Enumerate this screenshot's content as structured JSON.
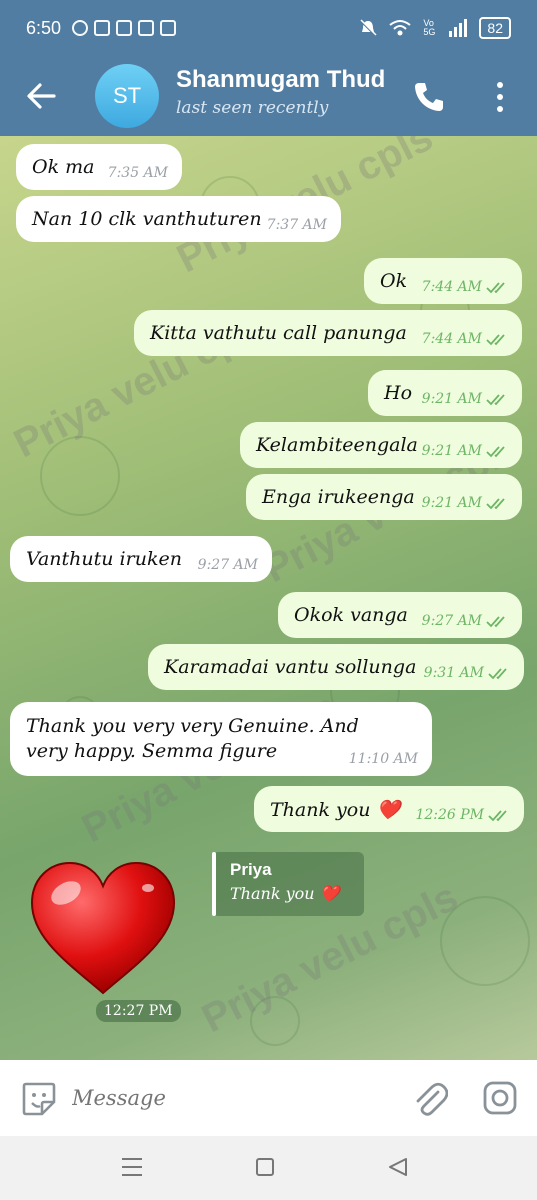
{
  "status_bar": {
    "time": "6:50",
    "battery": "82",
    "network": "Vo 5G",
    "icons_left": [
      "messenger-icon",
      "telegram-icon",
      "paytm-icon",
      "phonepe-icon",
      "play-store-icon"
    ],
    "icons_right": [
      "mute-icon",
      "wifi-icon",
      "signal-icon",
      "battery-icon"
    ]
  },
  "header": {
    "avatar_initials": "ST",
    "contact_name": "Shanmugam Thud",
    "last_seen": "last seen recently"
  },
  "messages": [
    {
      "dir": "in",
      "text": "Ok ma",
      "time": "7:35 AM"
    },
    {
      "dir": "in",
      "text": "Nan 10 clk vanthuturen",
      "time": "7:37 AM"
    },
    {
      "dir": "out",
      "text": "Ok",
      "time": "7:44 AM"
    },
    {
      "dir": "out",
      "text": "Kitta vathutu call panunga",
      "time": "7:44 AM"
    },
    {
      "dir": "out",
      "text": "Ho",
      "time": "9:21 AM"
    },
    {
      "dir": "out",
      "text": "Kelambiteengala",
      "time": "9:21 AM"
    },
    {
      "dir": "out",
      "text": "Enga irukeenga",
      "time": "9:21 AM"
    },
    {
      "dir": "in",
      "text": "Vanthutu iruken",
      "time": "9:27 AM"
    },
    {
      "dir": "out",
      "text": "Okok vanga",
      "time": "9:27 AM"
    },
    {
      "dir": "out",
      "text": "Karamadai vantu sollunga",
      "time": "9:31 AM"
    },
    {
      "dir": "in",
      "text": "Thank you very very Genuine. And very happy. Semma figure",
      "time": "11:10 AM"
    },
    {
      "dir": "out",
      "text": "Thank you ❤️",
      "time": "12:26 PM"
    }
  ],
  "sticker": {
    "icon": "red-heart-icon",
    "time": "12:27 PM",
    "reply_to": {
      "name": "Priya",
      "text": "Thank you ❤️"
    }
  },
  "watermark": "Priya velu cpls",
  "input": {
    "placeholder": "Message"
  },
  "colors": {
    "header": "#517da2",
    "bubble_out": "#effdde",
    "bubble_in": "#ffffff",
    "tick": "#6db565"
  }
}
